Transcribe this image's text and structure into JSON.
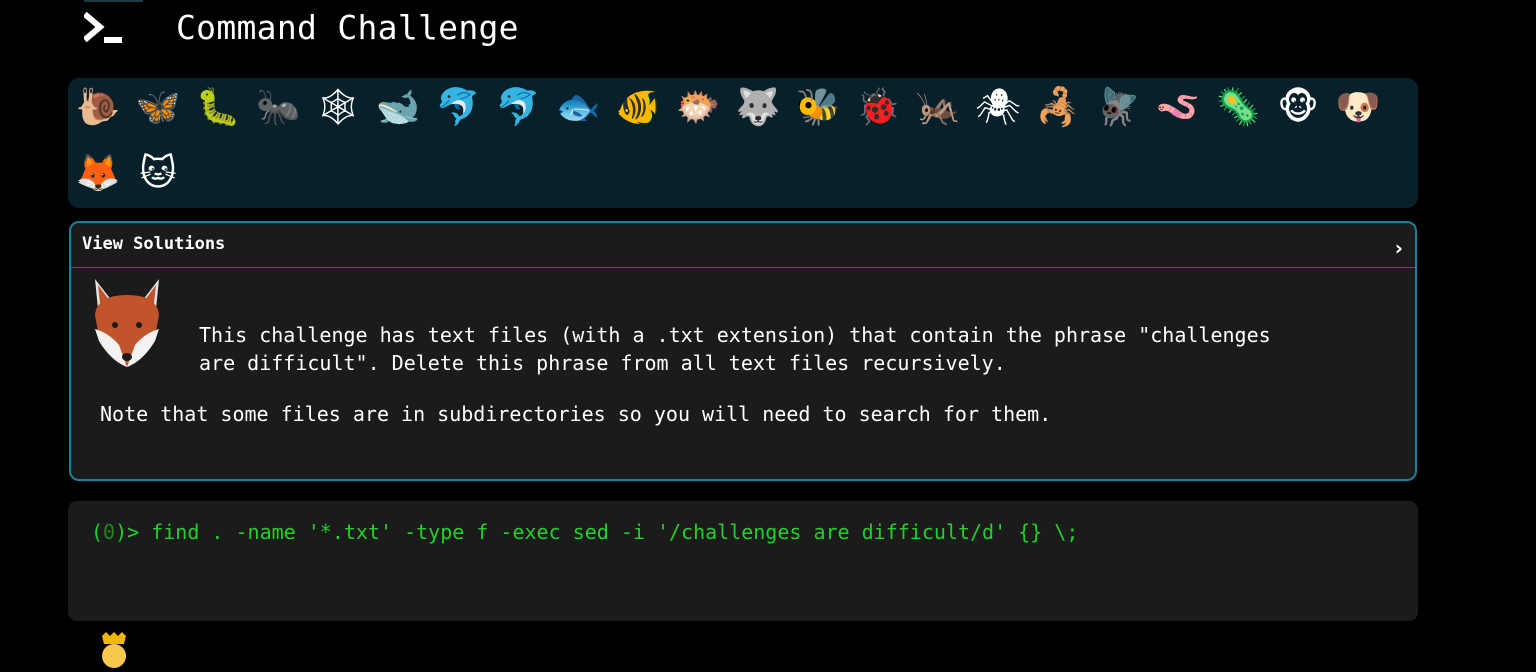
{
  "header": {
    "title": "Command Challenge",
    "logo_icon": "terminal-prompt-icon"
  },
  "animals": [
    {
      "name": "snail",
      "glyph": "🐌"
    },
    {
      "name": "butterfly",
      "glyph": "🦋"
    },
    {
      "name": "caterpillar",
      "glyph": "🐛"
    },
    {
      "name": "ant",
      "glyph": "🐜"
    },
    {
      "name": "spider-web",
      "glyph": "🕸"
    },
    {
      "name": "whale",
      "glyph": "🐋"
    },
    {
      "name": "dolphin-blue",
      "glyph": "🐬"
    },
    {
      "name": "dolphin-grey",
      "glyph": "🐬"
    },
    {
      "name": "fish",
      "glyph": "🐟"
    },
    {
      "name": "tropical-fish",
      "glyph": "🐠"
    },
    {
      "name": "blowfish",
      "glyph": "🐡"
    },
    {
      "name": "wolf",
      "glyph": "🐺"
    },
    {
      "name": "bee",
      "glyph": "🐝"
    },
    {
      "name": "ladybug",
      "glyph": "🐞"
    },
    {
      "name": "cricket",
      "glyph": "🦗"
    },
    {
      "name": "spider",
      "glyph": "🕷"
    },
    {
      "name": "scorpion",
      "glyph": "🦂"
    },
    {
      "name": "fly",
      "glyph": "🪰"
    },
    {
      "name": "worm",
      "glyph": "🪱"
    },
    {
      "name": "microbe",
      "glyph": "🦠"
    },
    {
      "name": "chimp",
      "glyph": "🐵"
    },
    {
      "name": "dog",
      "glyph": "🐶"
    },
    {
      "name": "fox",
      "glyph": "🦊"
    },
    {
      "name": "cat",
      "glyph": "🐱"
    }
  ],
  "solutions": {
    "label": "View Solutions",
    "chevron": "›"
  },
  "challenge": {
    "text": "This challenge has text files (with a .txt extension) that contain the phrase \"challenges\nare difficult\". Delete this phrase from all text files recursively.",
    "note": "Note that some files are in subdirectories so you will need to search for them."
  },
  "terminal": {
    "status_open": "(",
    "status_code": "0",
    "status_close": ")> ",
    "command": "find . -name '*.txt' -type f -exec sed -i '/challenges are difficult/d' {} \\;"
  },
  "colors": {
    "accent": "#1f7f9b",
    "terminal_green": "#22d02a",
    "tray_bg": "#07202a",
    "panel_bg": "#1b1b1b"
  }
}
